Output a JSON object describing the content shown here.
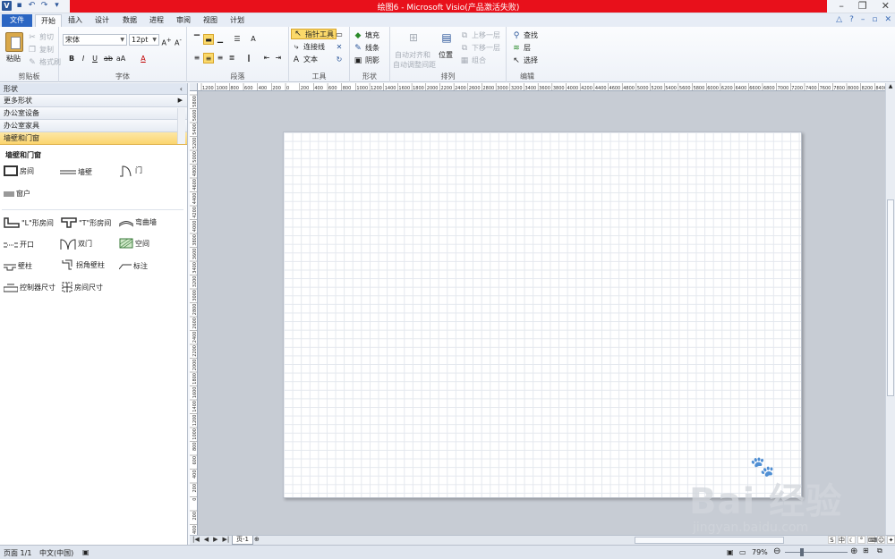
{
  "window": {
    "title": "绘图6 - Microsoft Visio(产品激活失败)",
    "controls": [
      "–",
      "❐",
      "✕"
    ]
  },
  "tabs": [
    "文件",
    "开始",
    "插入",
    "设计",
    "数据",
    "进程",
    "审阅",
    "视图",
    "计划"
  ],
  "tab_active": "开始",
  "ribbon": {
    "clipboard": {
      "paste": "粘贴",
      "cut": "剪切",
      "copy": "复制",
      "format_painter": "格式刷",
      "label": "剪贴板"
    },
    "font": {
      "name": "宋体",
      "size": "12pt",
      "label": "字体"
    },
    "paragraph": {
      "label": "段落"
    },
    "tools": {
      "pointer": "指针工具",
      "connector": "连接线",
      "text": "文本",
      "label": "工具"
    },
    "shape": {
      "fill": "填充",
      "line": "线条",
      "shadow": "阴影",
      "label": "形状"
    },
    "arrange": {
      "auto_align": "自动对齐和",
      "auto_space": "自动调整间距",
      "position": "位置",
      "bring_forward": "上移一层",
      "send_backward": "下移一层",
      "group": "组合",
      "label": "排列"
    },
    "edit": {
      "find": "查找",
      "layer": "层",
      "select": "选择",
      "label": "编辑"
    }
  },
  "shapes_pane": {
    "header": "形状",
    "more_shapes": "更多形状",
    "stencils": [
      "办公室设备",
      "办公室家具",
      "墙壁和门窗"
    ],
    "active_stencil": "墙壁和门窗",
    "stencil_title": "墙壁和门窗",
    "items": {
      "room": "房间",
      "wall": "墙壁",
      "door": "门",
      "window": "窗户",
      "l_room": "\"L\"形房间",
      "t_room": "\"T\"形房间",
      "curved_wall": "弯曲墙",
      "opening": "开口",
      "double_door": "双门",
      "space": "空间",
      "pillar": "壁柱",
      "corner_pillar": "拐角壁柱",
      "dimension_label": "标注",
      "controller_dim": "控制器尺寸",
      "room_dim": "房间尺寸"
    }
  },
  "ruler": {
    "h_labels": [
      "1200",
      "1000",
      "800",
      "600",
      "400",
      "200",
      "0",
      "200",
      "400",
      "600",
      "800",
      "1000",
      "1200",
      "1400",
      "1600",
      "1800",
      "2000",
      "2200",
      "2400",
      "2600",
      "2800",
      "3000",
      "3200",
      "3400",
      "3600",
      "3800",
      "4000",
      "4200",
      "4400",
      "4600",
      "4800",
      "5000",
      "5200",
      "5400",
      "5600",
      "5800",
      "6000",
      "6200",
      "6400",
      "6600",
      "6800",
      "7000",
      "7200",
      "7400",
      "7600",
      "7800",
      "8000",
      "8200",
      "8400"
    ],
    "v_labels": [
      "5800",
      "5600",
      "5400",
      "5200",
      "5000",
      "4800",
      "4600",
      "4400",
      "4200",
      "4000",
      "3800",
      "3600",
      "3400",
      "3200",
      "3000",
      "2800",
      "2600",
      "2400",
      "2200",
      "2000",
      "1800",
      "1600",
      "1400",
      "1200",
      "1000",
      "800",
      "600",
      "400",
      "200",
      "0",
      "200",
      "400"
    ]
  },
  "page_tab": "页-1",
  "status": {
    "page": "页面 1/1",
    "language": "中文(中国)",
    "zoom": "79%"
  },
  "watermark": {
    "brand": "Bai 经验",
    "url": "jingyan.baidu.com"
  },
  "colors": {
    "title_bar": "#e8101b",
    "file_tab": "#2b66c3",
    "active_stencil": "#fbd56f"
  }
}
